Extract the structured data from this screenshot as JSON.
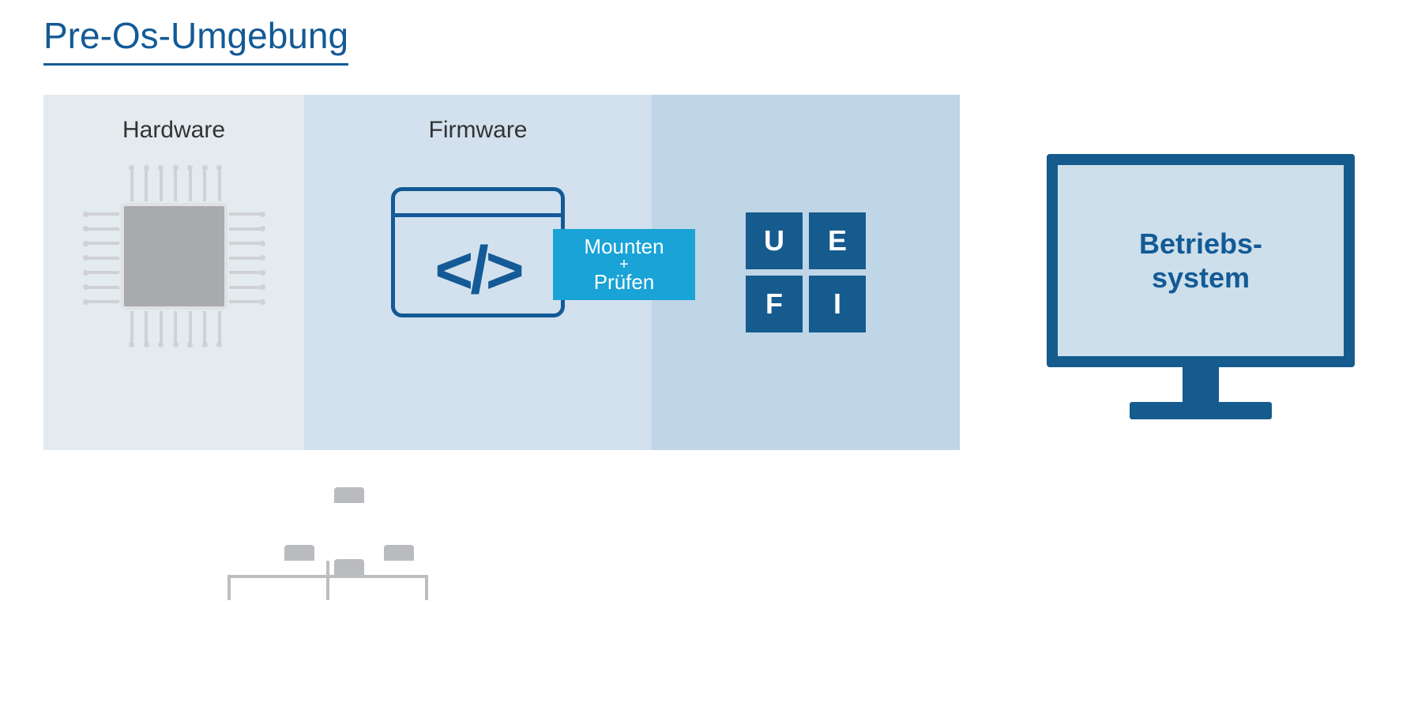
{
  "title": "Pre-Os-Umgebung",
  "panels": {
    "hardware": {
      "label": "Hardware"
    },
    "firmware": {
      "label": "Firmware",
      "code_glyph": "</>"
    },
    "mount": {
      "line1": "Mounten",
      "plus": "+",
      "line2": "Prüfen"
    },
    "uefi": [
      "U",
      "E",
      "F",
      "I"
    ]
  },
  "monitor": {
    "line1": "Betriebs-",
    "line2": "system"
  },
  "colors": {
    "navy": "#135a96",
    "cyan": "#19a3d6",
    "panel1": "#e3ebef",
    "panel2": "#d2e1ed",
    "panel3": "#bfd6e6"
  }
}
